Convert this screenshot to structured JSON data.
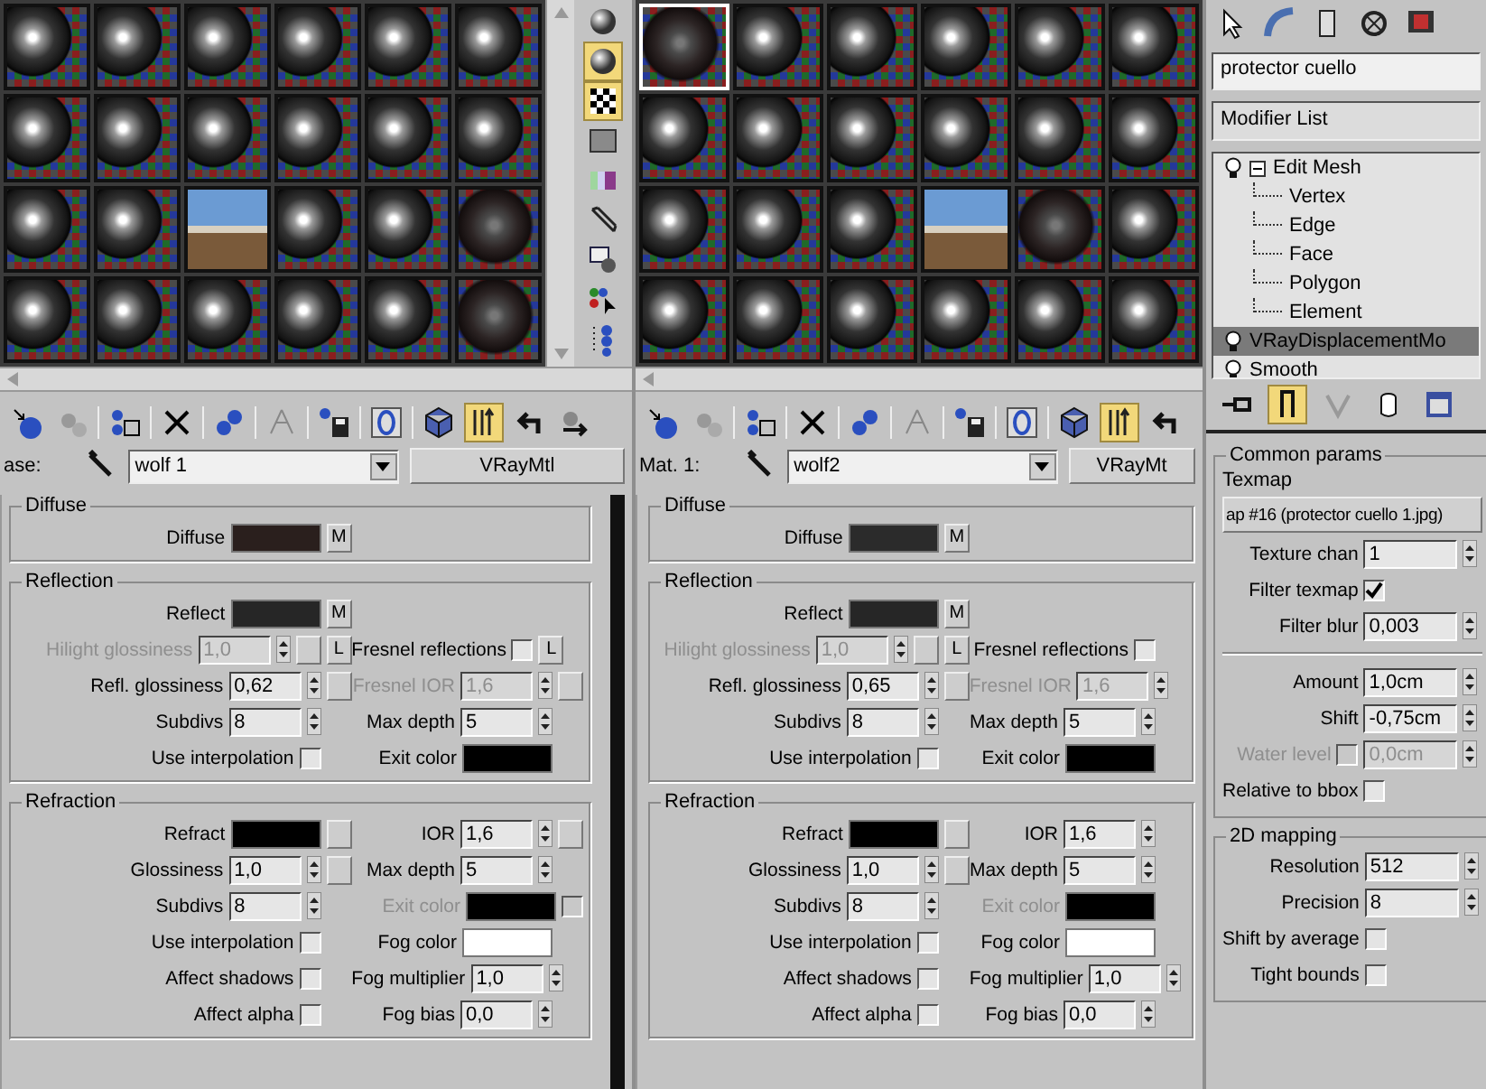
{
  "editors": [
    {
      "slots": [
        {
          "kind": "sphere",
          "selected": false
        },
        {
          "kind": "sphere",
          "selected": false
        },
        {
          "kind": "sphere",
          "selected": false
        },
        {
          "kind": "sphere",
          "selected": false
        },
        {
          "kind": "sphere",
          "selected": false
        },
        {
          "kind": "sphere",
          "selected": false
        },
        {
          "kind": "sphere",
          "selected": false
        },
        {
          "kind": "sphere",
          "selected": false
        },
        {
          "kind": "sphere",
          "selected": false
        },
        {
          "kind": "sphere",
          "selected": false
        },
        {
          "kind": "sphere",
          "selected": false
        },
        {
          "kind": "sphere",
          "selected": false
        },
        {
          "kind": "sphere",
          "selected": false
        },
        {
          "kind": "sphere",
          "selected": false
        },
        {
          "kind": "photo",
          "selected": false
        },
        {
          "kind": "sphere",
          "selected": false
        },
        {
          "kind": "sphere",
          "selected": false
        },
        {
          "kind": "textured",
          "selected": false
        },
        {
          "kind": "sphere",
          "selected": false
        },
        {
          "kind": "sphere",
          "selected": false
        },
        {
          "kind": "sphere",
          "selected": false
        },
        {
          "kind": "sphere",
          "selected": false
        },
        {
          "kind": "sphere",
          "selected": false
        },
        {
          "kind": "textured",
          "selected": false
        }
      ],
      "side_toolbar": [
        {
          "selected": false
        },
        {
          "selected": true
        },
        {
          "selected": true
        },
        {
          "selected": false
        },
        {
          "selected": false
        },
        {
          "selected": false
        },
        {
          "selected": false
        },
        {
          "selected": false
        },
        {
          "selected": false
        }
      ],
      "toolbar": [
        {
          "selected": false
        },
        {
          "selected": false
        },
        {
          "selected": false
        },
        {
          "selected": false
        },
        {
          "selected": false
        },
        {
          "selected": false
        },
        {
          "selected": false
        },
        {
          "selected": false
        },
        {
          "selected": false
        },
        {
          "selected": true
        },
        {
          "selected": false
        },
        {
          "selected": false
        }
      ],
      "name_label": "ase:",
      "material_name": "wolf 1",
      "material_type": "VRayMtl",
      "rollouts": [
        {
          "title": "Diffuse",
          "rows": [
            {
              "left": {
                "kind": "color",
                "label": "Diffuse",
                "color": "#2a1f1d",
                "disabled": false,
                "map_button": true,
                "map_label": "M"
              }
            }
          ]
        },
        {
          "title": "Reflection",
          "rows": [
            {
              "left": {
                "kind": "color",
                "label": "Reflect",
                "color": "#262626",
                "disabled": false,
                "map_button": true,
                "map_label": "M"
              }
            },
            {
              "left": {
                "kind": "spinner",
                "label": "Hilight glossiness",
                "value": "1,0",
                "disabled": true,
                "map_button": true,
                "lock": "L"
              },
              "right": {
                "kind": "checkbox",
                "label": "Fresnel reflections",
                "checked": false,
                "disabled": false,
                "lock": "L"
              }
            },
            {
              "left": {
                "kind": "spinner",
                "label": "Refl. glossiness",
                "value": "0,62",
                "disabled": false,
                "map_button": true
              },
              "right": {
                "kind": "spinner",
                "label": "Fresnel IOR",
                "value": "1,6",
                "disabled": true,
                "map_button": true
              }
            },
            {
              "left": {
                "kind": "spinner",
                "label": "Subdivs",
                "value": "8",
                "disabled": false,
                "map_button": false
              },
              "right": {
                "kind": "spinner",
                "label": "Max depth",
                "value": "5",
                "disabled": false,
                "map_button": false
              }
            },
            {
              "left": {
                "kind": "checkbox",
                "label": "Use interpolation",
                "checked": false,
                "disabled": false
              },
              "right": {
                "kind": "color",
                "label": "Exit color",
                "color": "#000000",
                "disabled": false,
                "map_button": false
              }
            }
          ]
        },
        {
          "title": "Refraction",
          "rows": [
            {
              "left": {
                "kind": "color",
                "label": "Refract",
                "color": "#000000",
                "disabled": false,
                "map_button": true
              },
              "right": {
                "kind": "spinner",
                "label": "IOR",
                "value": "1,6",
                "disabled": false,
                "map_button": true
              }
            },
            {
              "left": {
                "kind": "spinner",
                "label": "Glossiness",
                "value": "1,0",
                "disabled": false,
                "map_button": true
              },
              "right": {
                "kind": "spinner",
                "label": "Max depth",
                "value": "5",
                "disabled": false,
                "map_button": false
              }
            },
            {
              "left": {
                "kind": "spinner",
                "label": "Subdivs",
                "value": "8",
                "disabled": false,
                "map_button": false
              },
              "right": {
                "kind": "color",
                "label": "Exit color",
                "color": "#000000",
                "disabled": true,
                "map_button": false,
                "check": {
                  "checked": false
                }
              }
            },
            {
              "left": {
                "kind": "checkbox",
                "label": "Use interpolation",
                "checked": false,
                "disabled": false
              },
              "right": {
                "kind": "color",
                "label": "Fog color",
                "color": "#ffffff",
                "disabled": false,
                "map_button": false
              }
            },
            {
              "left": {
                "kind": "checkbox",
                "label": "Affect shadows",
                "checked": false,
                "disabled": false
              },
              "right": {
                "kind": "spinner",
                "label": "Fog multiplier",
                "value": "1,0",
                "disabled": false,
                "map_button": false
              }
            },
            {
              "left": {
                "kind": "checkbox",
                "label": "Affect alpha",
                "checked": false,
                "disabled": false
              },
              "right": {
                "kind": "spinner",
                "label": "Fog bias",
                "value": "0,0",
                "disabled": false,
                "map_button": false
              }
            }
          ]
        }
      ]
    },
    {
      "slots": [
        {
          "kind": "textured",
          "selected": true
        },
        {
          "kind": "sphere",
          "selected": false
        },
        {
          "kind": "sphere",
          "selected": false
        },
        {
          "kind": "sphere",
          "selected": false
        },
        {
          "kind": "sphere",
          "selected": false
        },
        {
          "kind": "sphere",
          "selected": false
        },
        {
          "kind": "sphere",
          "selected": false
        },
        {
          "kind": "sphere",
          "selected": false
        },
        {
          "kind": "sphere",
          "selected": false
        },
        {
          "kind": "sphere",
          "selected": false
        },
        {
          "kind": "sphere",
          "selected": false
        },
        {
          "kind": "sphere",
          "selected": false
        },
        {
          "kind": "sphere",
          "selected": false
        },
        {
          "kind": "sphere",
          "selected": false
        },
        {
          "kind": "sphere",
          "selected": false
        },
        {
          "kind": "photo",
          "selected": false
        },
        {
          "kind": "textured",
          "selected": false
        },
        {
          "kind": "sphere",
          "selected": false
        },
        {
          "kind": "sphere",
          "selected": false
        },
        {
          "kind": "sphere",
          "selected": false
        },
        {
          "kind": "sphere",
          "selected": false
        },
        {
          "kind": "sphere",
          "selected": false
        },
        {
          "kind": "sphere",
          "selected": false
        },
        {
          "kind": "sphere",
          "selected": false
        }
      ],
      "toolbar": [
        {
          "selected": false
        },
        {
          "selected": false
        },
        {
          "selected": false
        },
        {
          "selected": false
        },
        {
          "selected": false
        },
        {
          "selected": false
        },
        {
          "selected": false
        },
        {
          "selected": false
        },
        {
          "selected": false
        },
        {
          "selected": true
        },
        {
          "selected": false
        }
      ],
      "name_label": "Mat. 1:",
      "material_name": "wolf2",
      "material_type": "VRayMt",
      "rollouts": [
        {
          "title": "Diffuse",
          "rows": [
            {
              "left": {
                "kind": "color",
                "label": "Diffuse",
                "color": "#2b2b2b",
                "disabled": false,
                "map_button": true,
                "map_label": "M"
              }
            }
          ]
        },
        {
          "title": "Reflection",
          "rows": [
            {
              "left": {
                "kind": "color",
                "label": "Reflect",
                "color": "#262626",
                "disabled": false,
                "map_button": true,
                "map_label": "M"
              }
            },
            {
              "left": {
                "kind": "spinner",
                "label": "Hilight glossiness",
                "value": "1,0",
                "disabled": true,
                "map_button": true,
                "lock": "L"
              },
              "right": {
                "kind": "checkbox",
                "label": "Fresnel reflections",
                "checked": false,
                "disabled": false
              }
            },
            {
              "left": {
                "kind": "spinner",
                "label": "Refl. glossiness",
                "value": "0,65",
                "disabled": false,
                "map_button": true
              },
              "right": {
                "kind": "spinner",
                "label": "Fresnel IOR",
                "value": "1,6",
                "disabled": true,
                "map_button": false
              }
            },
            {
              "left": {
                "kind": "spinner",
                "label": "Subdivs",
                "value": "8",
                "disabled": false,
                "map_button": false
              },
              "right": {
                "kind": "spinner",
                "label": "Max depth",
                "value": "5",
                "disabled": false,
                "map_button": false
              }
            },
            {
              "left": {
                "kind": "checkbox",
                "label": "Use interpolation",
                "checked": false,
                "disabled": false
              },
              "right": {
                "kind": "color",
                "label": "Exit color",
                "color": "#000000",
                "disabled": false,
                "map_button": false
              }
            }
          ]
        },
        {
          "title": "Refraction",
          "rows": [
            {
              "left": {
                "kind": "color",
                "label": "Refract",
                "color": "#000000",
                "disabled": false,
                "map_button": true
              },
              "right": {
                "kind": "spinner",
                "label": "IOR",
                "value": "1,6",
                "disabled": false,
                "map_button": false
              }
            },
            {
              "left": {
                "kind": "spinner",
                "label": "Glossiness",
                "value": "1,0",
                "disabled": false,
                "map_button": true
              },
              "right": {
                "kind": "spinner",
                "label": "Max depth",
                "value": "5",
                "disabled": false,
                "map_button": false
              }
            },
            {
              "left": {
                "kind": "spinner",
                "label": "Subdivs",
                "value": "8",
                "disabled": false,
                "map_button": false
              },
              "right": {
                "kind": "color",
                "label": "Exit color",
                "color": "#000000",
                "disabled": true,
                "map_button": false
              }
            },
            {
              "left": {
                "kind": "checkbox",
                "label": "Use interpolation",
                "checked": false,
                "disabled": false
              },
              "right": {
                "kind": "color",
                "label": "Fog color",
                "color": "#ffffff",
                "disabled": false,
                "map_button": false
              }
            },
            {
              "left": {
                "kind": "checkbox",
                "label": "Affect shadows",
                "checked": false,
                "disabled": false
              },
              "right": {
                "kind": "spinner",
                "label": "Fog multiplier",
                "value": "1,0",
                "disabled": false,
                "map_button": false
              }
            },
            {
              "left": {
                "kind": "checkbox",
                "label": "Affect alpha",
                "checked": false,
                "disabled": false
              },
              "right": {
                "kind": "spinner",
                "label": "Fog bias",
                "value": "0,0",
                "disabled": false,
                "map_button": false
              }
            }
          ]
        }
      ]
    }
  ],
  "command_panel": {
    "object_name": "protector cuello",
    "modifier_list": "Modifier List",
    "stack": [
      {
        "label": "Edit Mesh",
        "expanded": true,
        "selected": false,
        "children": [
          {
            "label": "Vertex",
            "selected": false
          },
          {
            "label": "Edge",
            "selected": false
          },
          {
            "label": "Face",
            "selected": false
          },
          {
            "label": "Polygon",
            "selected": false
          },
          {
            "label": "Element",
            "selected": false
          }
        ]
      },
      {
        "label": "VRayDisplacementMo",
        "selected": true
      },
      {
        "label": "Smooth",
        "selected": false
      }
    ],
    "stack_toolbar": [
      {
        "selected": false
      },
      {
        "selected": true
      },
      {
        "selected": false
      },
      {
        "selected": false
      },
      {
        "selected": false
      }
    ],
    "common_params": {
      "title": "Common params",
      "texmap_label": "Texmap",
      "texmap_button": "ap #16 (protector cuello 1.jpg)",
      "rows": [
        {
          "kind": "spinner",
          "label": "Texture chan",
          "value": "1",
          "disabled": false
        },
        {
          "kind": "checkbox",
          "label": "Filter texmap",
          "checked": true,
          "disabled": false
        },
        {
          "kind": "spinner",
          "label": "Filter blur",
          "value": "0,003",
          "disabled": false
        },
        {
          "kind": "separator"
        },
        {
          "kind": "spinner",
          "label": "Amount",
          "value": "1,0cm",
          "disabled": false
        },
        {
          "kind": "spinner",
          "label": "Shift",
          "value": "-0,75cm",
          "disabled": false
        },
        {
          "kind": "check_spinner",
          "label": "Water level",
          "checked": false,
          "value": "0,0cm",
          "disabled": true
        },
        {
          "kind": "checkbox",
          "label": "Relative to bbox",
          "checked": false,
          "disabled": false
        }
      ]
    },
    "mapping": {
      "title": "2D mapping",
      "rows": [
        {
          "kind": "spinner",
          "label": "Resolution",
          "value": "512",
          "disabled": false
        },
        {
          "kind": "spinner",
          "label": "Precision",
          "value": "8",
          "disabled": false
        },
        {
          "kind": "checkbox",
          "label": "Shift by average",
          "checked": false,
          "disabled": false
        },
        {
          "kind": "checkbox",
          "label": "Tight bounds",
          "checked": false,
          "disabled": false
        }
      ]
    }
  }
}
